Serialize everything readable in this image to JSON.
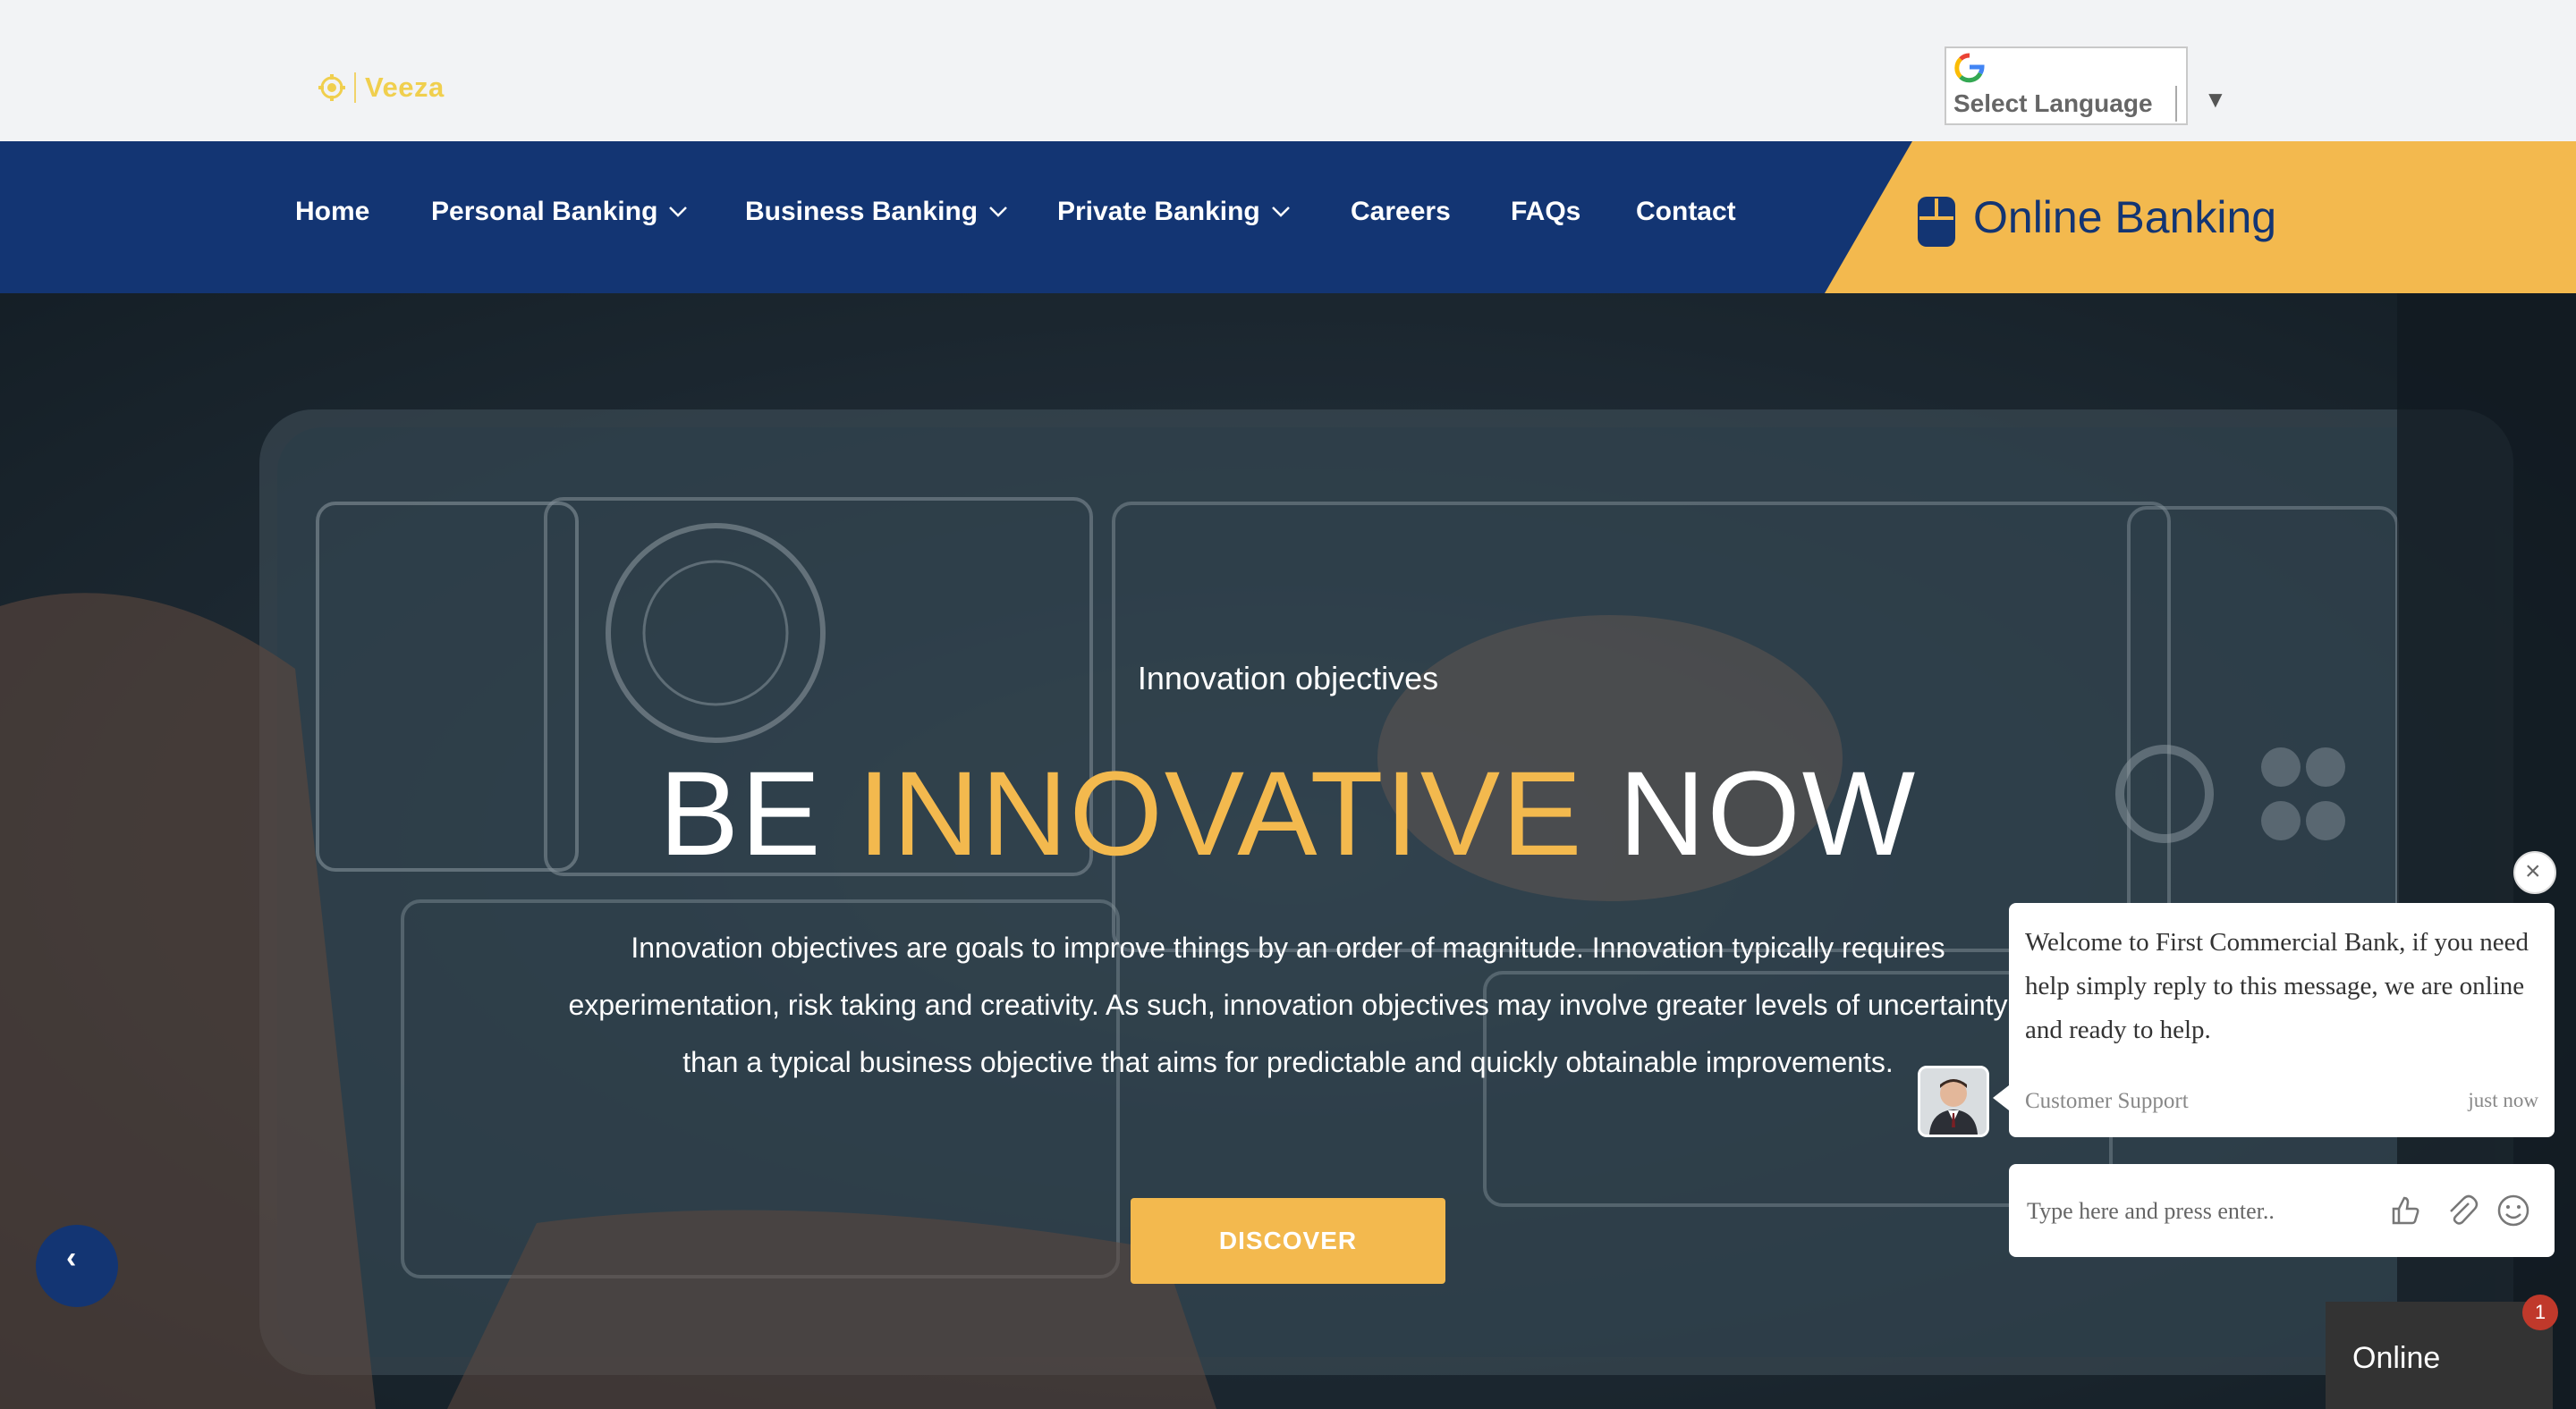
{
  "header": {
    "logo_text": "Veeza",
    "language": {
      "label": "Select Language",
      "arrow": "▼"
    }
  },
  "nav": {
    "items": [
      {
        "label": "Home",
        "has_dropdown": false
      },
      {
        "label": "Personal Banking",
        "has_dropdown": true
      },
      {
        "label": "Business Banking",
        "has_dropdown": true
      },
      {
        "label": "Private Banking",
        "has_dropdown": true
      },
      {
        "label": "Careers",
        "has_dropdown": false
      },
      {
        "label": "FAQs",
        "has_dropdown": false
      },
      {
        "label": "Contact",
        "has_dropdown": false
      }
    ],
    "online_banking_label": "Online Banking"
  },
  "hero": {
    "subtitle": "Innovation objectives",
    "title_part1": "BE",
    "title_accent": "INNOVATIVE",
    "title_part2": "NOW",
    "description": "Innovation objectives are goals to improve things by an order of magnitude. Innovation typically requires experimentation, risk taking and creativity. As such, innovation objectives may involve greater levels of uncertainty than a typical business objective that aims for predictable and quickly obtainable improvements.",
    "cta_label": "DISCOVER",
    "prev_arrow": "‹"
  },
  "chat": {
    "close_symbol": "×",
    "message": "Welcome to First Commercial Bank, if you need help simply reply to this message, we are online and ready to help.",
    "sender": "Customer Support",
    "time": "just now",
    "input_placeholder": "Type here and press enter..",
    "status_label": "Online",
    "unread_count": "1"
  },
  "colors": {
    "navy": "#133573",
    "gold": "#f3b94e",
    "logo_yellow": "#f0cf4e"
  },
  "icons": [
    "veeza-logo-icon",
    "google-g-icon",
    "chevron-down-icon",
    "online-banking-icon",
    "chevron-left-icon",
    "close-icon",
    "thumbs-up-icon",
    "paperclip-icon",
    "smiley-icon"
  ]
}
